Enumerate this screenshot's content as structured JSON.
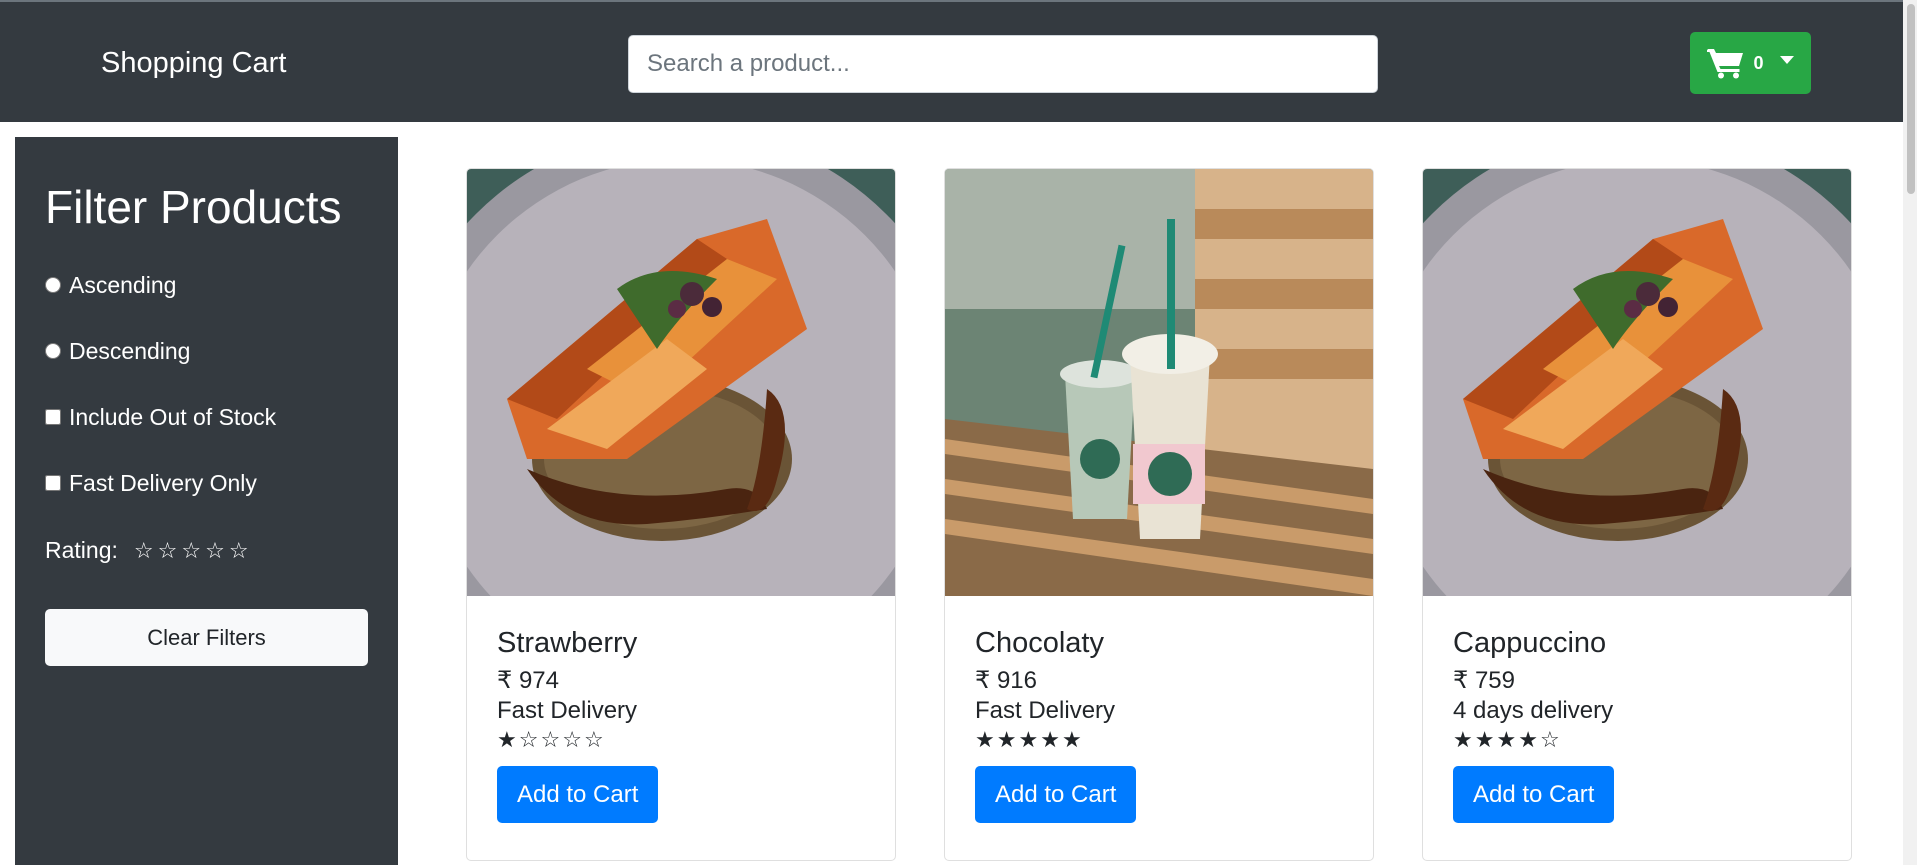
{
  "header": {
    "brand": "Shopping Cart",
    "search_placeholder": "Search a product...",
    "search_value": "",
    "cart_count": "0"
  },
  "sidebar": {
    "title": "Filter Products",
    "options": [
      {
        "label": "Ascending",
        "type": "radio",
        "checked": false
      },
      {
        "label": "Descending",
        "type": "radio",
        "checked": false
      },
      {
        "label": "Include Out of Stock",
        "type": "checkbox",
        "checked": false
      },
      {
        "label": "Fast Delivery Only",
        "type": "checkbox",
        "checked": false
      }
    ],
    "rating_label": "Rating:",
    "rating_value": 0,
    "clear_label": "Clear Filters"
  },
  "products": [
    {
      "name": "Strawberry",
      "price": "₹ 974",
      "delivery": "Fast Delivery",
      "rating": 1,
      "button": "Add to Cart",
      "image": "salmon"
    },
    {
      "name": "Chocolaty",
      "price": "₹ 916",
      "delivery": "Fast Delivery",
      "rating": 5,
      "button": "Add to Cart",
      "image": "drinks"
    },
    {
      "name": "Cappuccino",
      "price": "₹ 759",
      "delivery": "4 days delivery",
      "rating": 4,
      "button": "Add to Cart",
      "image": "salmon"
    }
  ],
  "colors": {
    "navbar": "#343a40",
    "cart_button": "#28a745",
    "add_button": "#007bff"
  }
}
